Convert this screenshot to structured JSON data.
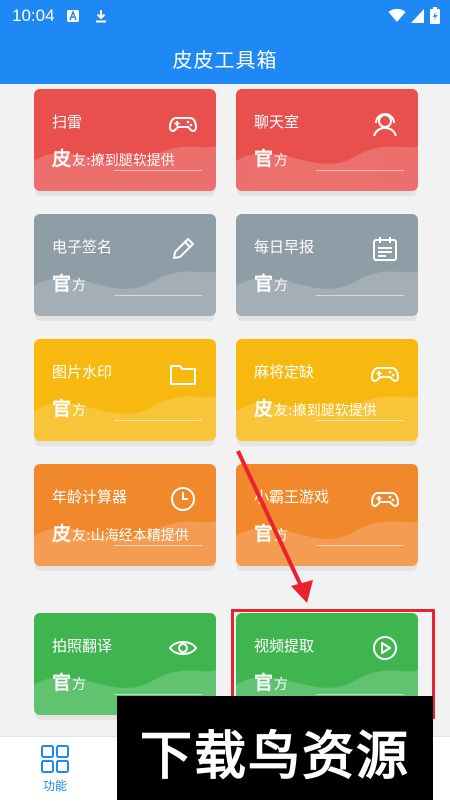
{
  "status_bar": {
    "time": "10:04"
  },
  "header": {
    "title": "皮皮工具箱"
  },
  "cards": [
    {
      "name": "扫雷",
      "source_lead": "皮",
      "source_rest": "友:撩到腿软提供",
      "color": "#e9504d",
      "icon": "gamepad-icon"
    },
    {
      "name": "聊天室",
      "source_lead": "官",
      "source_rest": "方",
      "color": "#e9504d",
      "icon": "headset-icon"
    },
    {
      "name": "电子签名",
      "source_lead": "官",
      "source_rest": "方",
      "color": "#8f9da6",
      "icon": "pencil-icon"
    },
    {
      "name": "每日早报",
      "source_lead": "官",
      "source_rest": "方",
      "color": "#8f9da6",
      "icon": "calendar-icon"
    },
    {
      "name": "图片水印",
      "source_lead": "官",
      "source_rest": "方",
      "color": "#f7b90f",
      "icon": "folder-icon"
    },
    {
      "name": "麻将定缺",
      "source_lead": "皮",
      "source_rest": "友:撩到腿软提供",
      "color": "#f7b90f",
      "icon": "gamepad-icon"
    },
    {
      "name": "年龄计算器",
      "source_lead": "皮",
      "source_rest": "友:山海经本精提供",
      "color": "#f2882c",
      "icon": "clock-icon"
    },
    {
      "name": "小霸王游戏",
      "source_lead": "官",
      "source_rest": "方",
      "color": "#f2882c",
      "icon": "gamepad-icon"
    },
    {
      "name": "拍照翻译",
      "source_lead": "官",
      "source_rest": "方",
      "color": "#3fb550",
      "icon": "eye-icon"
    },
    {
      "name": "视频提取",
      "source_lead": "官",
      "source_rest": "方",
      "color": "#3fb550",
      "icon": "play-circle-icon"
    }
  ],
  "bottom_nav": {
    "items": [
      {
        "label": "功能",
        "icon": "grid-icon"
      }
    ]
  },
  "watermark": {
    "text": "下载鸟资源"
  },
  "annotation": {
    "color": "#e8232f"
  }
}
